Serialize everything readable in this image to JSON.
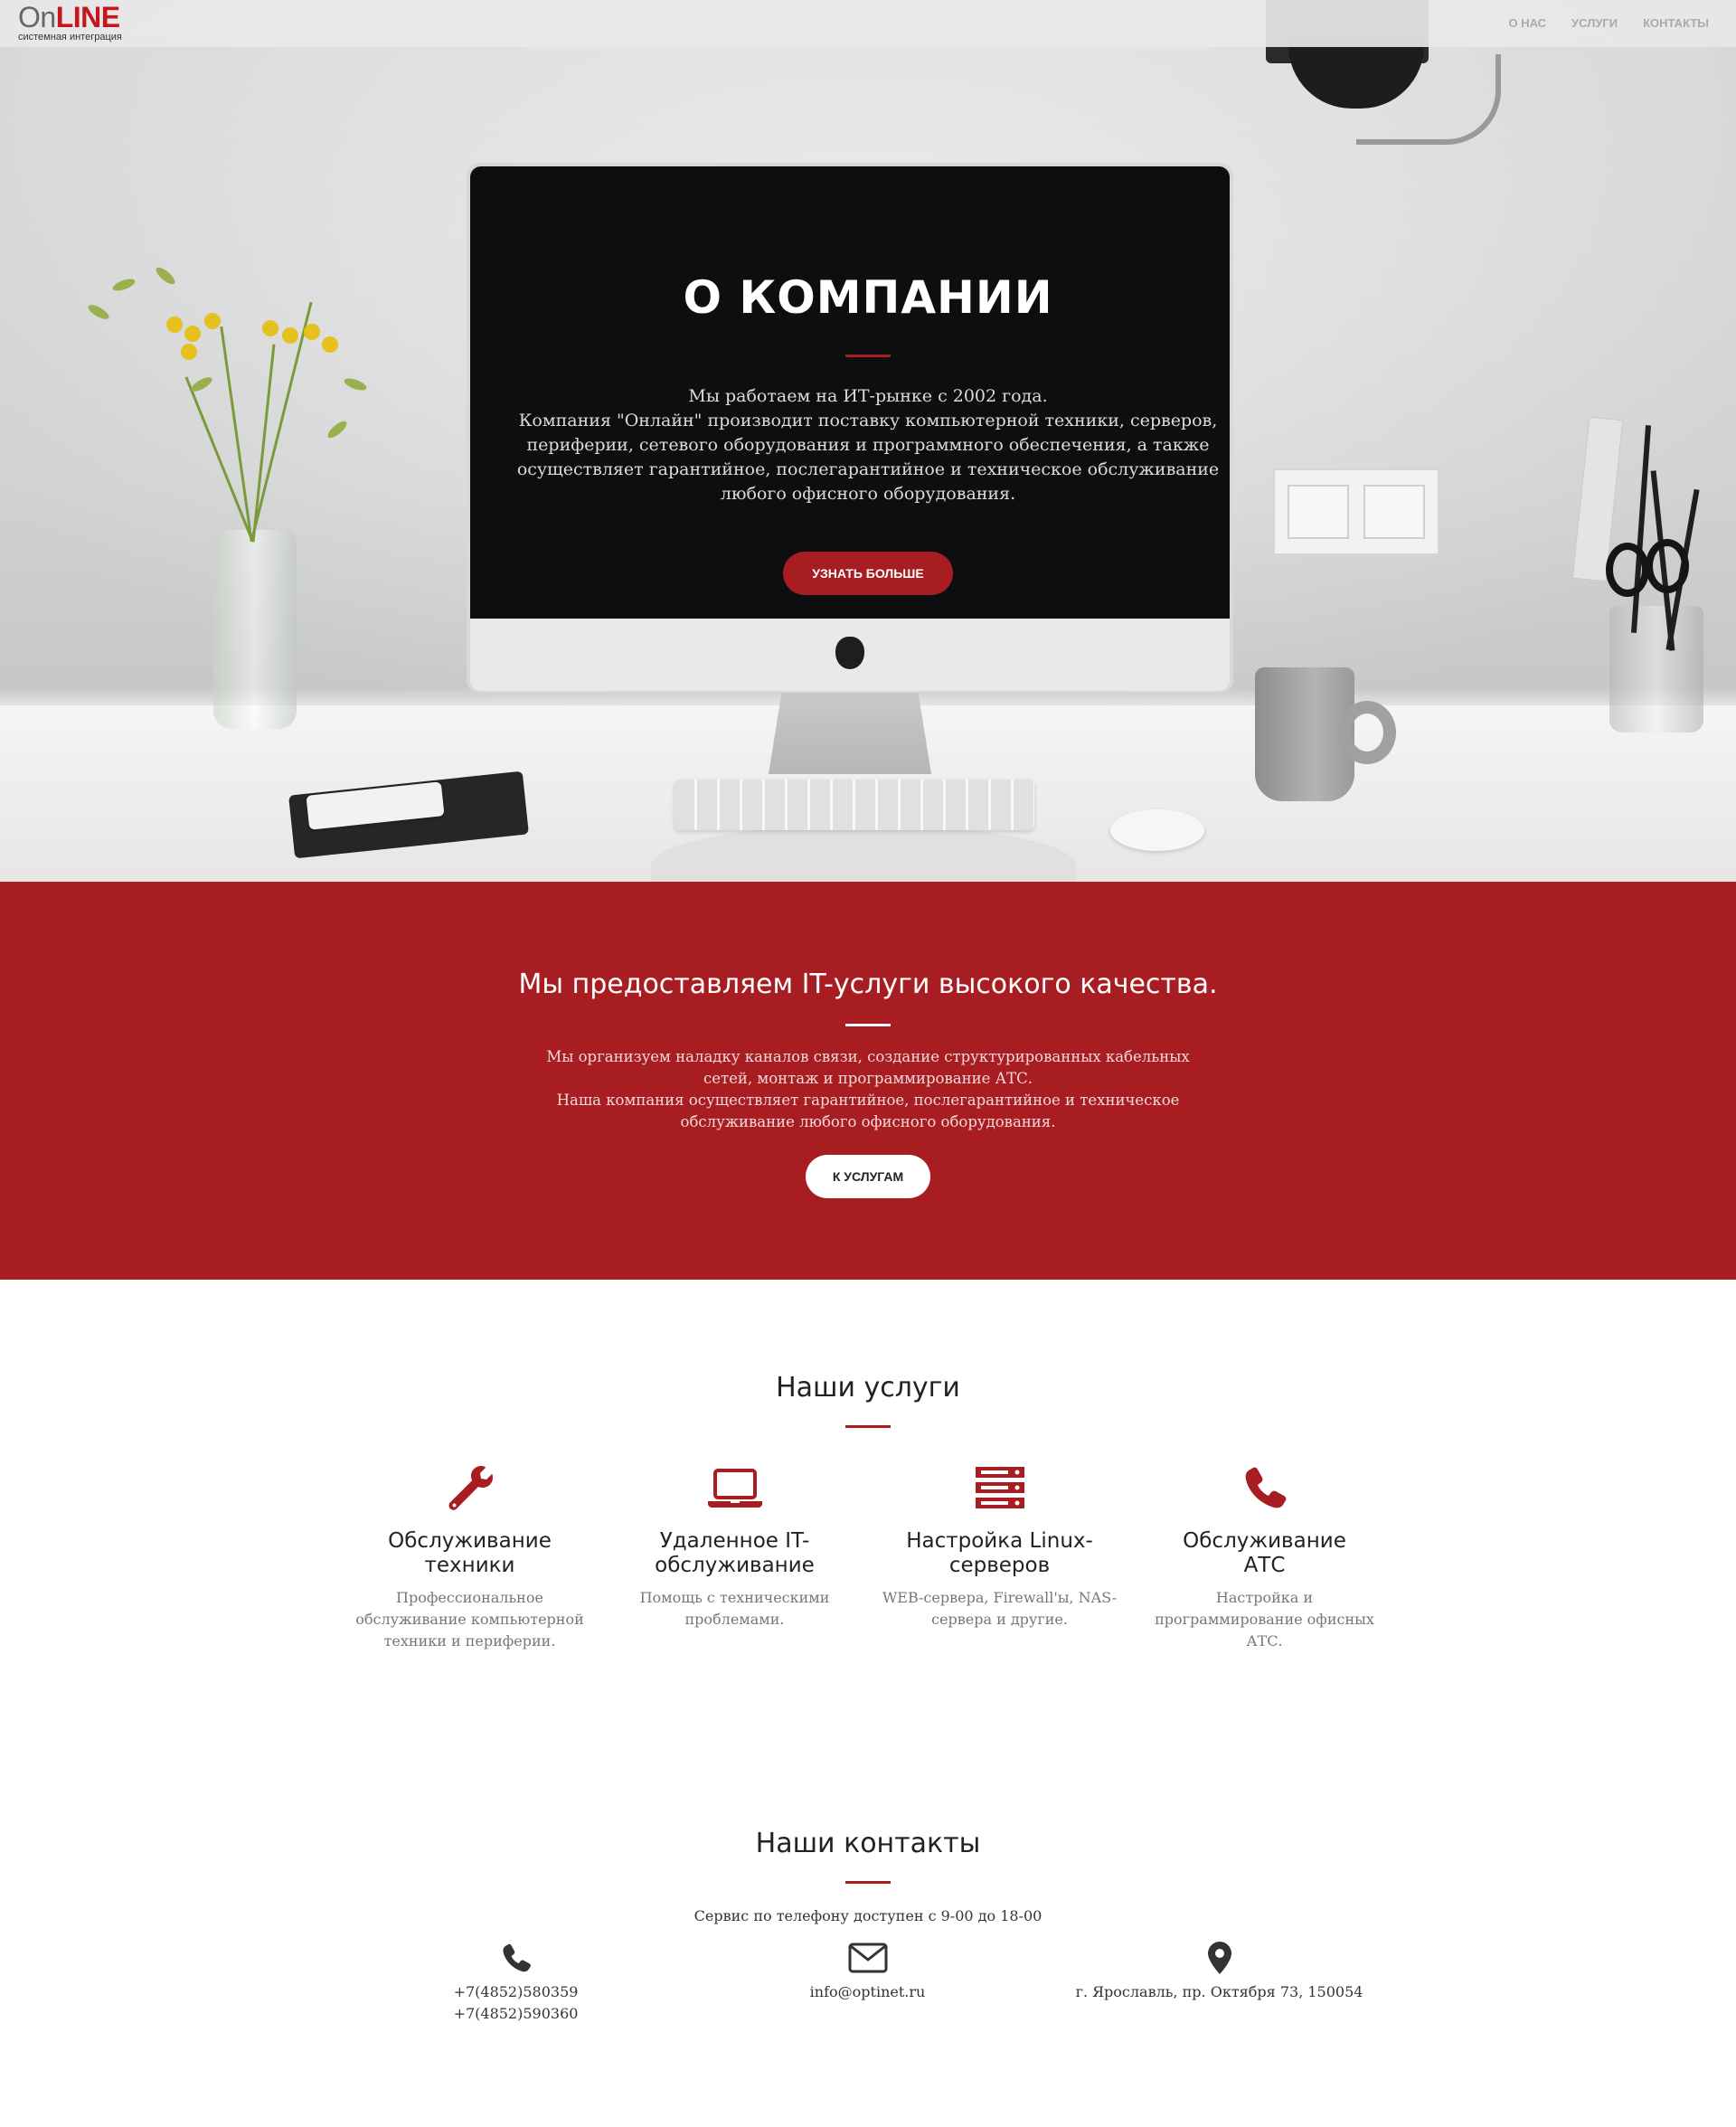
{
  "brand": {
    "logo_on": "On",
    "logo_line": "LINE",
    "logo_sub": "системная интеграция"
  },
  "nav": {
    "items": [
      {
        "label": "О нас"
      },
      {
        "label": "Услуги"
      },
      {
        "label": "Контакты"
      }
    ]
  },
  "hero": {
    "title": "О компании",
    "lines": [
      "Мы работаем на ИТ-рынке с 2002 года.",
      "Компания \"Онлайн\" производит поставку компьютерной техники, серверов,",
      "периферии, сетевого оборудования и программного обеспечения, а также",
      "осуществляет гарантийное, послегарантийное и техническое обслуживание",
      "любого офисного оборудования."
    ],
    "button": "Узнать больше"
  },
  "about": {
    "title": "Мы предоставляем IT-услуги высокого качества.",
    "lines": [
      "Мы организуем наладку каналов связи, создание структурированных кабельных",
      "сетей, монтаж и программирование АТС.",
      "Наша компания осуществляет гарантийное, послегарантийное и техническое",
      "обслуживание любого офисного оборудования."
    ],
    "button": "К услугам"
  },
  "services": {
    "title": "Наши услуги",
    "items": [
      {
        "icon": "wrench-icon",
        "title": "Обслуживание техники",
        "text": "Профессиональное обслуживание компьютерной техники и периферии."
      },
      {
        "icon": "laptop-icon",
        "title": "Удаленное IT-обслуживание",
        "text": "Помощь с техническими проблемами."
      },
      {
        "icon": "server-icon",
        "title": "Настройка Linux-серверов",
        "text": "WEB-сервера, Firewall'ы, NAS-сервера и другие."
      },
      {
        "icon": "phone-icon",
        "title": "Обслуживание АТС",
        "text": "Настройка и программирование офисных АТС."
      }
    ]
  },
  "contacts": {
    "title": "Наши контакты",
    "subtitle": "Сервис по телефону доступен с 9-00 до 18-00",
    "phone_1": "+7(4852)580359",
    "phone_2": "+7(4852)590360",
    "email": "info@optinet.ru",
    "address": "г. Ярославль, пр. Октября 73, 150054"
  },
  "colors": {
    "accent": "#a81d22",
    "logo_red": "#c4161c",
    "text_dark": "#222222",
    "text_muted": "#777777"
  }
}
